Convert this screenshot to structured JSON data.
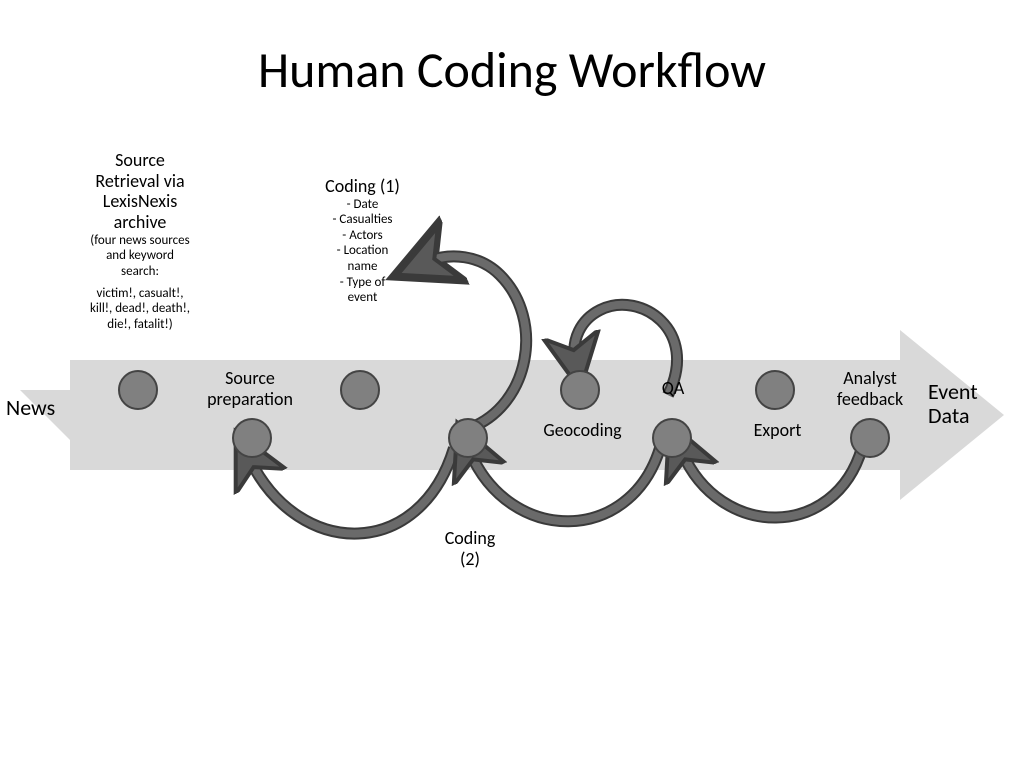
{
  "title": "Human Coding Workflow",
  "arrow": {
    "start_label": "News",
    "end_label_line1": "Event",
    "end_label_line2": "Data"
  },
  "source_retrieval": {
    "heading_line1": "Source",
    "heading_line2": "Retrieval via",
    "heading_line3": "LexisNexis",
    "heading_line4": "archive",
    "paren_line1": "(four news sources",
    "paren_line2": "and keyword",
    "paren_line3": "search:",
    "keywords_line1": "victim!, casualt!,",
    "keywords_line2": "kill!, dead!, death!,",
    "keywords_line3": "die!, fatalit!)"
  },
  "source_prep": {
    "line1": "Source",
    "line2": "preparation"
  },
  "coding1": {
    "heading": "Coding (1)",
    "item1": "- Date",
    "item2": "-  Casualties",
    "item3": "- Actors",
    "item4": "- Location",
    "item4b": "name",
    "item5": "- Type of",
    "item5b": "event"
  },
  "coding2": {
    "line1": "Coding",
    "line2": "(2)"
  },
  "geocoding": "Geocoding",
  "qa": "QA",
  "export": "Export",
  "analyst": {
    "line1": "Analyst",
    "line2": "feedback"
  }
}
